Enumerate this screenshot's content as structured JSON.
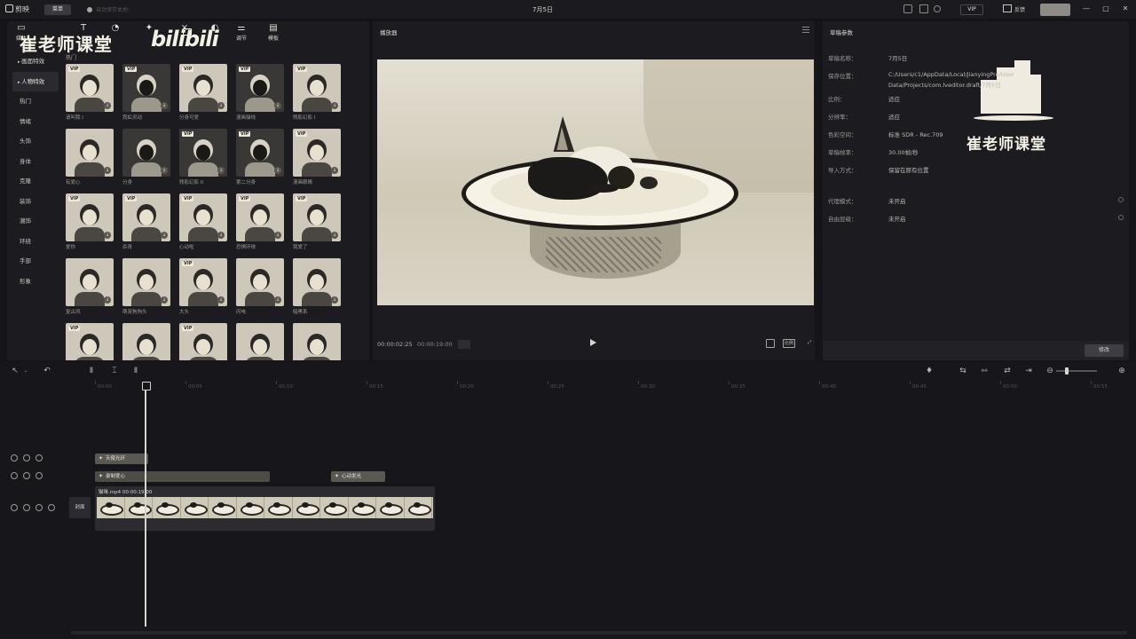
{
  "titlebar": {
    "app_name": "剪映",
    "menu": "菜单",
    "autosave": "自动保存本地：",
    "doc_title": "7月5日",
    "vip": "VIP",
    "feedback": "反馈",
    "window_controls": [
      "—",
      "▢",
      "✕"
    ]
  },
  "media": {
    "watermark": "崔老师课堂",
    "watermark_logo": "bilibili",
    "toolbar": [
      {
        "icon": "media-icon",
        "label": "媒体"
      },
      {
        "icon": "text-icon",
        "label": "T"
      },
      {
        "icon": "sticker-icon",
        "label": ""
      },
      {
        "icon": "effects-icon",
        "label": ""
      },
      {
        "icon": "transition-icon",
        "label": ""
      },
      {
        "icon": "filter-icon",
        "label": ""
      },
      {
        "icon": "adjust-icon",
        "label": "调节"
      },
      {
        "icon": "template-icon",
        "label": "模板"
      }
    ],
    "categories": [
      {
        "label": "画面特效",
        "section": true,
        "active": false
      },
      {
        "label": "人物特效",
        "section": true,
        "active": true
      },
      {
        "label": "热门",
        "section": false,
        "active": false
      },
      {
        "label": "情绪",
        "section": false,
        "active": false
      },
      {
        "label": "头饰",
        "section": false,
        "active": false
      },
      {
        "label": "身体",
        "section": false,
        "active": false
      },
      {
        "label": "克隆",
        "section": false,
        "active": false
      },
      {
        "label": "装饰",
        "section": false,
        "active": false
      },
      {
        "label": "潮饰",
        "section": false,
        "active": false
      },
      {
        "label": "环绕",
        "section": false,
        "active": false
      },
      {
        "label": "手部",
        "section": false,
        "active": false
      },
      {
        "label": "形象",
        "section": false,
        "active": false
      }
    ],
    "hot_label": "热门",
    "effects": [
      {
        "label": "请叫我 I",
        "vip": true,
        "dark": false
      },
      {
        "label": "霓虹灵动",
        "vip": true,
        "dark": true
      },
      {
        "label": "分身可爱",
        "vip": true,
        "dark": false
      },
      {
        "label": "漫画描线",
        "vip": true,
        "dark": true
      },
      {
        "label": "残影幻影 I",
        "vip": true,
        "dark": false
      },
      {
        "label": "有爱心",
        "vip": false,
        "dark": false
      },
      {
        "label": "分身",
        "vip": false,
        "dark": true
      },
      {
        "label": "残影幻影 II",
        "vip": true,
        "dark": true
      },
      {
        "label": "第二分身",
        "vip": true,
        "dark": true
      },
      {
        "label": "漫画眼睛",
        "vip": true,
        "dark": false
      },
      {
        "label": "爱你",
        "vip": true,
        "dark": false
      },
      {
        "label": "杀青",
        "vip": true,
        "dark": false
      },
      {
        "label": "心动啦",
        "vip": true,
        "dark": false
      },
      {
        "label": "恐惧环绕",
        "vip": true,
        "dark": false
      },
      {
        "label": "我爱了",
        "vip": true,
        "dark": false
      },
      {
        "label": "复古风",
        "vip": false,
        "dark": false
      },
      {
        "label": "萌宠狗狗头",
        "vip": false,
        "dark": false
      },
      {
        "label": "大头",
        "vip": true,
        "dark": false
      },
      {
        "label": "闪电",
        "vip": false,
        "dark": false
      },
      {
        "label": "暗黑系",
        "vip": false,
        "dark": false
      },
      {
        "label": "",
        "vip": true,
        "dark": false
      },
      {
        "label": "",
        "vip": false,
        "dark": false
      },
      {
        "label": "",
        "vip": true,
        "dark": false
      },
      {
        "label": "",
        "vip": false,
        "dark": false
      },
      {
        "label": "",
        "vip": false,
        "dark": false
      }
    ]
  },
  "player": {
    "title": "播放器",
    "current_time": "00:00:02:25",
    "total_time": "00:00:19:00",
    "controls": [
      "fullscreen-fit-icon",
      "ratio-icon",
      "fullscreen-icon"
    ],
    "ratio_label": "比例"
  },
  "props": {
    "title": "草稿参数",
    "rows": [
      {
        "label": "草稿名称：",
        "value": "7月5日"
      },
      {
        "label": "保存位置：",
        "value": "C:/Users/c1/AppData/Local/JianyingPro/User Data/Projects/com.lveditor.draft/7月5日"
      },
      {
        "label": "比例：",
        "value": "适应"
      },
      {
        "label": "分辨率：",
        "value": "适应"
      },
      {
        "label": "色彩空间：",
        "value": "标准 SDR - Rec.709"
      },
      {
        "label": "草稿帧率：",
        "value": "30.00帧/秒"
      },
      {
        "label": "导入方式：",
        "value": "保留在原有位置"
      }
    ],
    "toggles": [
      {
        "label": "代理模式：",
        "value": "未开启"
      },
      {
        "label": "自由层级：",
        "value": "未开启"
      }
    ],
    "modify_label": "修改",
    "watermark": "崔老师课堂"
  },
  "timeline": {
    "ticks": [
      "00:00",
      "00:05",
      "00:10",
      "00:15",
      "00:20",
      "00:25",
      "00:30",
      "00:35",
      "00:40",
      "00:45",
      "00:50",
      "00:55"
    ],
    "effect_clips": [
      {
        "label": "天使光环",
        "track": 0
      },
      {
        "label": "录制爱心",
        "track": 1
      },
      {
        "label": "心动发光",
        "track": 1
      }
    ],
    "video_label": "猫咪.mp4  00:00:19:00",
    "cover_label": "封面"
  }
}
